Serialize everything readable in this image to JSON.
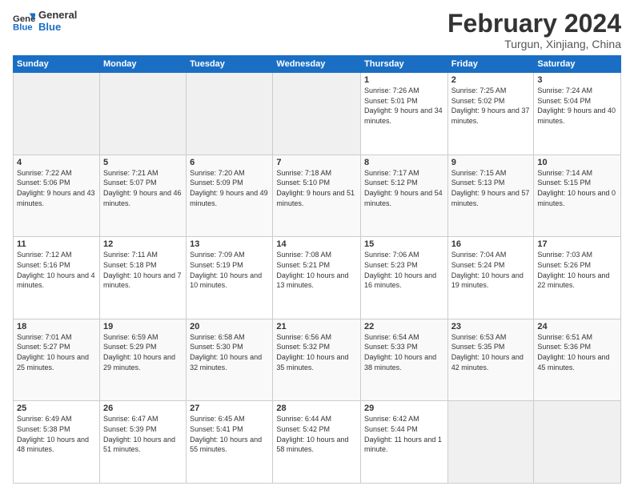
{
  "header": {
    "logo_line1": "General",
    "logo_line2": "Blue",
    "month": "February 2024",
    "location": "Turgun, Xinjiang, China"
  },
  "days_of_week": [
    "Sunday",
    "Monday",
    "Tuesday",
    "Wednesday",
    "Thursday",
    "Friday",
    "Saturday"
  ],
  "weeks": [
    [
      {
        "day": "",
        "data": ""
      },
      {
        "day": "",
        "data": ""
      },
      {
        "day": "",
        "data": ""
      },
      {
        "day": "",
        "data": ""
      },
      {
        "day": "1",
        "data": "Sunrise: 7:26 AM\nSunset: 5:01 PM\nDaylight: 9 hours and 34 minutes."
      },
      {
        "day": "2",
        "data": "Sunrise: 7:25 AM\nSunset: 5:02 PM\nDaylight: 9 hours and 37 minutes."
      },
      {
        "day": "3",
        "data": "Sunrise: 7:24 AM\nSunset: 5:04 PM\nDaylight: 9 hours and 40 minutes."
      }
    ],
    [
      {
        "day": "4",
        "data": "Sunrise: 7:22 AM\nSunset: 5:06 PM\nDaylight: 9 hours and 43 minutes."
      },
      {
        "day": "5",
        "data": "Sunrise: 7:21 AM\nSunset: 5:07 PM\nDaylight: 9 hours and 46 minutes."
      },
      {
        "day": "6",
        "data": "Sunrise: 7:20 AM\nSunset: 5:09 PM\nDaylight: 9 hours and 49 minutes."
      },
      {
        "day": "7",
        "data": "Sunrise: 7:18 AM\nSunset: 5:10 PM\nDaylight: 9 hours and 51 minutes."
      },
      {
        "day": "8",
        "data": "Sunrise: 7:17 AM\nSunset: 5:12 PM\nDaylight: 9 hours and 54 minutes."
      },
      {
        "day": "9",
        "data": "Sunrise: 7:15 AM\nSunset: 5:13 PM\nDaylight: 9 hours and 57 minutes."
      },
      {
        "day": "10",
        "data": "Sunrise: 7:14 AM\nSunset: 5:15 PM\nDaylight: 10 hours and 0 minutes."
      }
    ],
    [
      {
        "day": "11",
        "data": "Sunrise: 7:12 AM\nSunset: 5:16 PM\nDaylight: 10 hours and 4 minutes."
      },
      {
        "day": "12",
        "data": "Sunrise: 7:11 AM\nSunset: 5:18 PM\nDaylight: 10 hours and 7 minutes."
      },
      {
        "day": "13",
        "data": "Sunrise: 7:09 AM\nSunset: 5:19 PM\nDaylight: 10 hours and 10 minutes."
      },
      {
        "day": "14",
        "data": "Sunrise: 7:08 AM\nSunset: 5:21 PM\nDaylight: 10 hours and 13 minutes."
      },
      {
        "day": "15",
        "data": "Sunrise: 7:06 AM\nSunset: 5:23 PM\nDaylight: 10 hours and 16 minutes."
      },
      {
        "day": "16",
        "data": "Sunrise: 7:04 AM\nSunset: 5:24 PM\nDaylight: 10 hours and 19 minutes."
      },
      {
        "day": "17",
        "data": "Sunrise: 7:03 AM\nSunset: 5:26 PM\nDaylight: 10 hours and 22 minutes."
      }
    ],
    [
      {
        "day": "18",
        "data": "Sunrise: 7:01 AM\nSunset: 5:27 PM\nDaylight: 10 hours and 25 minutes."
      },
      {
        "day": "19",
        "data": "Sunrise: 6:59 AM\nSunset: 5:29 PM\nDaylight: 10 hours and 29 minutes."
      },
      {
        "day": "20",
        "data": "Sunrise: 6:58 AM\nSunset: 5:30 PM\nDaylight: 10 hours and 32 minutes."
      },
      {
        "day": "21",
        "data": "Sunrise: 6:56 AM\nSunset: 5:32 PM\nDaylight: 10 hours and 35 minutes."
      },
      {
        "day": "22",
        "data": "Sunrise: 6:54 AM\nSunset: 5:33 PM\nDaylight: 10 hours and 38 minutes."
      },
      {
        "day": "23",
        "data": "Sunrise: 6:53 AM\nSunset: 5:35 PM\nDaylight: 10 hours and 42 minutes."
      },
      {
        "day": "24",
        "data": "Sunrise: 6:51 AM\nSunset: 5:36 PM\nDaylight: 10 hours and 45 minutes."
      }
    ],
    [
      {
        "day": "25",
        "data": "Sunrise: 6:49 AM\nSunset: 5:38 PM\nDaylight: 10 hours and 48 minutes."
      },
      {
        "day": "26",
        "data": "Sunrise: 6:47 AM\nSunset: 5:39 PM\nDaylight: 10 hours and 51 minutes."
      },
      {
        "day": "27",
        "data": "Sunrise: 6:45 AM\nSunset: 5:41 PM\nDaylight: 10 hours and 55 minutes."
      },
      {
        "day": "28",
        "data": "Sunrise: 6:44 AM\nSunset: 5:42 PM\nDaylight: 10 hours and 58 minutes."
      },
      {
        "day": "29",
        "data": "Sunrise: 6:42 AM\nSunset: 5:44 PM\nDaylight: 11 hours and 1 minute."
      },
      {
        "day": "",
        "data": ""
      },
      {
        "day": "",
        "data": ""
      }
    ]
  ]
}
